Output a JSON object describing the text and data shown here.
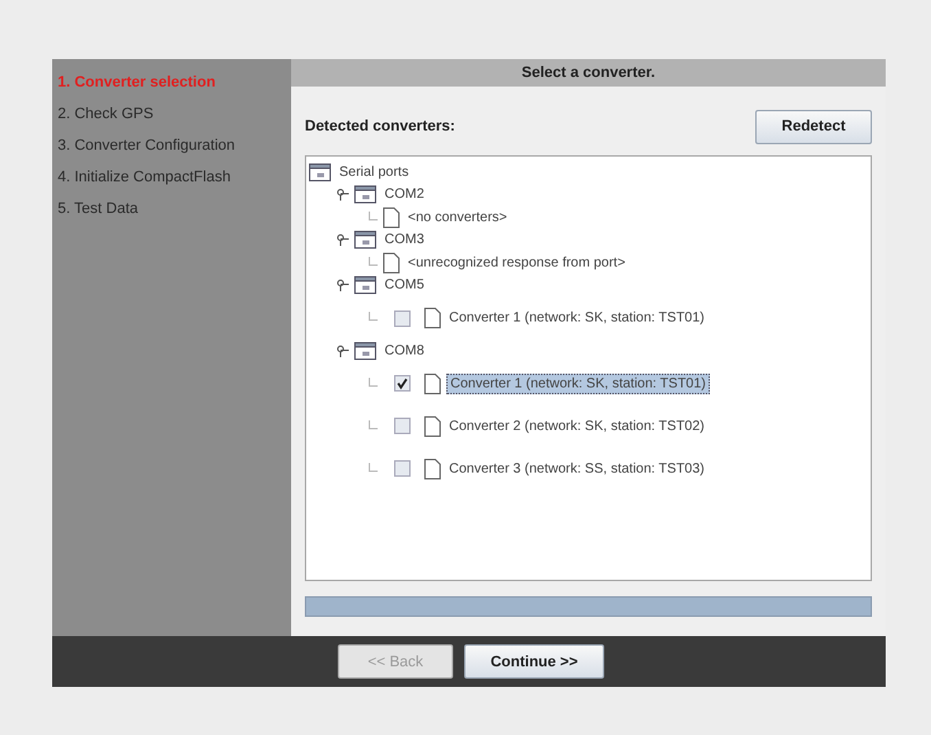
{
  "steps": [
    {
      "label": "1. Converter selection",
      "selected": true
    },
    {
      "label": "2. Check GPS",
      "selected": false
    },
    {
      "label": "3. Converter Configuration",
      "selected": false
    },
    {
      "label": "4. Initialize CompactFlash",
      "selected": false
    },
    {
      "label": "5. Test Data",
      "selected": false
    }
  ],
  "header": {
    "title": "Select a converter."
  },
  "detected_label": "Detected converters:",
  "redetect_button": "Redetect",
  "tree": {
    "label": "Serial ports",
    "kind": "folder",
    "children": [
      {
        "label": "COM2",
        "kind": "folder",
        "expanded": true,
        "children": [
          {
            "label": "<no converters>",
            "kind": "file"
          }
        ]
      },
      {
        "label": "COM3",
        "kind": "folder",
        "expanded": true,
        "children": [
          {
            "label": "<unrecognized response from port>",
            "kind": "file"
          }
        ]
      },
      {
        "label": "COM5",
        "kind": "folder",
        "expanded": true,
        "children": [
          {
            "label": "Converter 1 (network: SK, station: TST01)",
            "kind": "converter",
            "checked": false,
            "selected": false
          }
        ]
      },
      {
        "label": "COM8",
        "kind": "folder",
        "expanded": true,
        "children": [
          {
            "label": "Converter 1 (network: SK, station: TST01)",
            "kind": "converter",
            "checked": true,
            "selected": true
          },
          {
            "label": "Converter 2 (network: SK, station: TST02)",
            "kind": "converter",
            "checked": false,
            "selected": false
          },
          {
            "label": "Converter 3 (network: SS, station: TST03)",
            "kind": "converter",
            "checked": false,
            "selected": false
          }
        ]
      }
    ]
  },
  "progress": {
    "level": 1
  },
  "buttons": [
    {
      "label": "<< Back",
      "disabled": true
    },
    {
      "label": "Continue >>",
      "disabled": false
    }
  ]
}
